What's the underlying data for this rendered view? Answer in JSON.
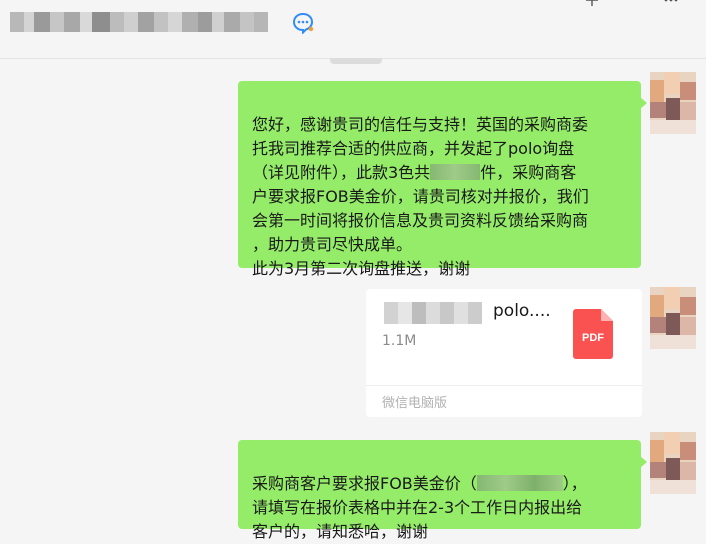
{
  "header": {
    "icons": {
      "chat": "chat-bubble-icon",
      "add": "plus-icon",
      "more": "more-icon"
    }
  },
  "messages": [
    {
      "type": "text",
      "lines": [
        "您好，感谢贵司的信任与支持！英国的采购商委",
        "托我司推荐合适的供应商，并发起了polo询盘",
        "（详见附件），此款3色共",
        "件，采购商客",
        "户要求报FOB美金价，请贵司核对并报价，我们",
        "会第一时间将报价信息及贵司资料反馈给采购商",
        "，助力贵司尽快成单。",
        "此为3月第二次询盘推送，谢谢"
      ]
    },
    {
      "type": "file",
      "name": "polo....",
      "size": "1.1M",
      "file_type": "PDF",
      "source": "微信电脑版"
    },
    {
      "type": "text",
      "lines": [
        "采购商客户要求报FOB美金价（",
        "），",
        "请填写在报价表格中并在2-3个工作日内报出给",
        "客户的，请知悉哈，谢谢"
      ]
    }
  ],
  "colors": {
    "bubble": "#95ec69",
    "background": "#f5f5f5",
    "pdf": "#fa5151"
  }
}
